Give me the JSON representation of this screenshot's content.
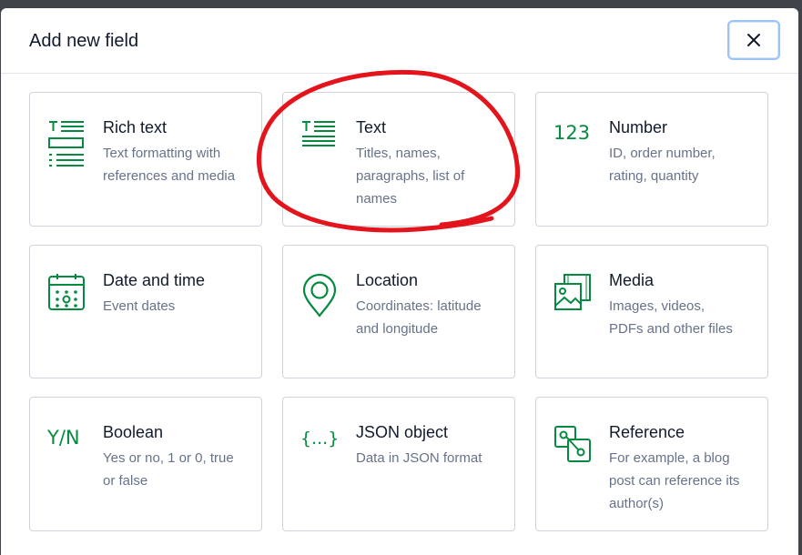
{
  "dialog": {
    "title": "Add new field",
    "close_label": "×"
  },
  "fields": [
    {
      "name": "Rich text",
      "desc": "Text formatting with references and media",
      "icon": "rich-text-icon"
    },
    {
      "name": "Text",
      "desc": "Titles, names, paragraphs, list of names",
      "icon": "text-icon"
    },
    {
      "name": "Number",
      "desc": "ID, order number, rating, quantity",
      "icon": "number-icon",
      "icon_text": "123"
    },
    {
      "name": "Date and time",
      "desc": "Event dates",
      "icon": "calendar-icon"
    },
    {
      "name": "Location",
      "desc": "Coordinates: latitude and longitude",
      "icon": "location-pin-icon"
    },
    {
      "name": "Media",
      "desc": "Images, videos, PDFs and other files",
      "icon": "media-icon"
    },
    {
      "name": "Boolean",
      "desc": "Yes or no, 1 or 0, true or false",
      "icon": "boolean-icon",
      "icon_text": "Y/N"
    },
    {
      "name": "JSON object",
      "desc": "Data in JSON format",
      "icon": "json-icon",
      "icon_text": "{...}"
    },
    {
      "name": "Reference",
      "desc": "For example, a blog post can reference its author(s)",
      "icon": "reference-icon"
    }
  ],
  "colors": {
    "accent": "#058a3f",
    "annotation": "#e3141b",
    "focus_ring": "#9cc3f5"
  }
}
